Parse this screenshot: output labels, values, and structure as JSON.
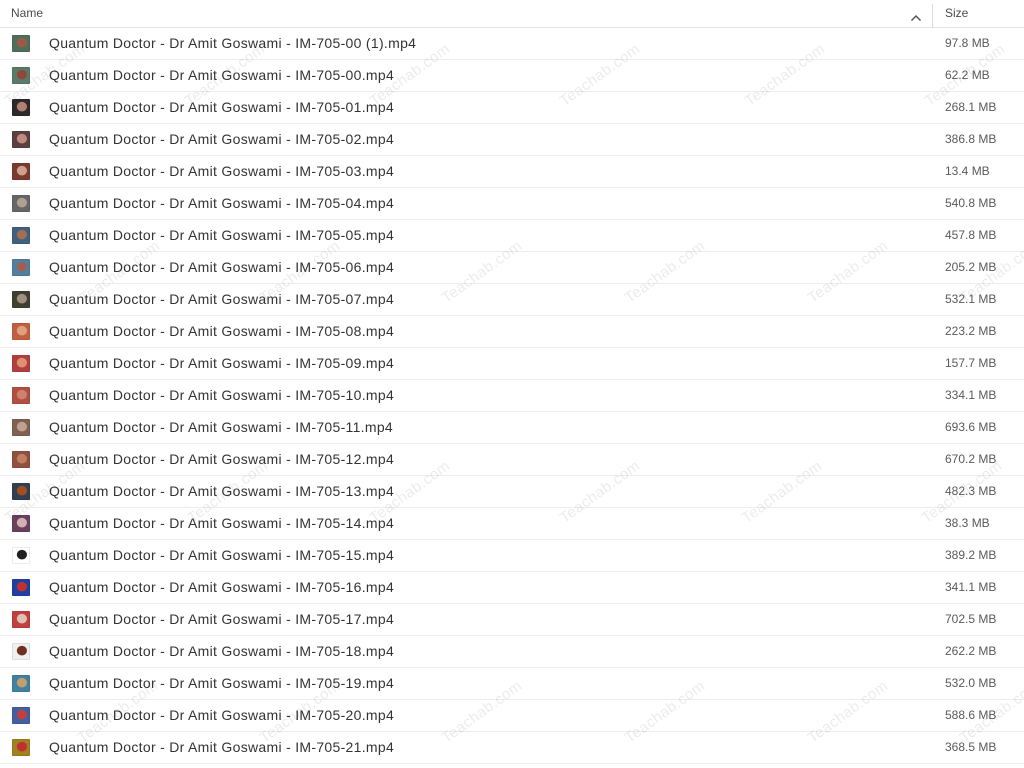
{
  "header": {
    "name_label": "Name",
    "size_label": "Size",
    "sort_icon": "chevron-up-icon"
  },
  "watermark": "Teachab.com",
  "files": [
    {
      "name": "Quantum Doctor - Dr Amit Goswami - IM-705-00 (1).mp4",
      "size": "97.8 MB",
      "thumb": [
        "#4f6e5a",
        "#9a5a46"
      ]
    },
    {
      "name": "Quantum Doctor - Dr Amit Goswami - IM-705-00.mp4",
      "size": "62.2 MB",
      "thumb": [
        "#5a7a6a",
        "#8c4a3a"
      ]
    },
    {
      "name": "Quantum Doctor - Dr Amit Goswami - IM-705-01.mp4",
      "size": "268.1 MB",
      "thumb": [
        "#2e2a2a",
        "#b08070"
      ]
    },
    {
      "name": "Quantum Doctor - Dr Amit Goswami - IM-705-02.mp4",
      "size": "386.8 MB",
      "thumb": [
        "#5a4040",
        "#c08a80"
      ]
    },
    {
      "name": "Quantum Doctor - Dr Amit Goswami - IM-705-03.mp4",
      "size": "13.4 MB",
      "thumb": [
        "#7a3a30",
        "#d0a090"
      ]
    },
    {
      "name": "Quantum Doctor - Dr Amit Goswami - IM-705-04.mp4",
      "size": "540.8 MB",
      "thumb": [
        "#666666",
        "#b0a090"
      ]
    },
    {
      "name": "Quantum Doctor - Dr Amit Goswami - IM-705-05.mp4",
      "size": "457.8 MB",
      "thumb": [
        "#406080",
        "#a07050"
      ]
    },
    {
      "name": "Quantum Doctor - Dr Amit Goswami - IM-705-06.mp4",
      "size": "205.2 MB",
      "thumb": [
        "#5080a0",
        "#a06050"
      ]
    },
    {
      "name": "Quantum Doctor - Dr Amit Goswami - IM-705-07.mp4",
      "size": "532.1 MB",
      "thumb": [
        "#404030",
        "#a09080"
      ]
    },
    {
      "name": "Quantum Doctor - Dr Amit Goswami - IM-705-08.mp4",
      "size": "223.2 MB",
      "thumb": [
        "#c06040",
        "#e0a080"
      ]
    },
    {
      "name": "Quantum Doctor - Dr Amit Goswami - IM-705-09.mp4",
      "size": "157.7 MB",
      "thumb": [
        "#b04040",
        "#e09070"
      ]
    },
    {
      "name": "Quantum Doctor - Dr Amit Goswami - IM-705-10.mp4",
      "size": "334.1 MB",
      "thumb": [
        "#b05040",
        "#d08070"
      ]
    },
    {
      "name": "Quantum Doctor - Dr Amit Goswami - IM-705-11.mp4",
      "size": "693.6 MB",
      "thumb": [
        "#806050",
        "#c0a090"
      ]
    },
    {
      "name": "Quantum Doctor - Dr Amit Goswami - IM-705-12.mp4",
      "size": "670.2 MB",
      "thumb": [
        "#905040",
        "#c08060"
      ]
    },
    {
      "name": "Quantum Doctor - Dr Amit Goswami - IM-705-13.mp4",
      "size": "482.3 MB",
      "thumb": [
        "#304050",
        "#a05020"
      ]
    },
    {
      "name": "Quantum Doctor - Dr Amit Goswami - IM-705-14.mp4",
      "size": "38.3 MB",
      "thumb": [
        "#6a4060",
        "#d0b0b0"
      ]
    },
    {
      "name": "Quantum Doctor - Dr Amit Goswami - IM-705-15.mp4",
      "size": "389.2 MB",
      "thumb": [
        "#ffffff",
        "#202020"
      ]
    },
    {
      "name": "Quantum Doctor - Dr Amit Goswami - IM-705-16.mp4",
      "size": "341.1 MB",
      "thumb": [
        "#2040a0",
        "#c03030"
      ]
    },
    {
      "name": "Quantum Doctor - Dr Amit Goswami - IM-705-17.mp4",
      "size": "702.5 MB",
      "thumb": [
        "#c04040",
        "#e0c0b0"
      ]
    },
    {
      "name": "Quantum Doctor - Dr Amit Goswami - IM-705-18.mp4",
      "size": "262.2 MB",
      "thumb": [
        "#f0f0f0",
        "#703020"
      ]
    },
    {
      "name": "Quantum Doctor - Dr Amit Goswami - IM-705-19.mp4",
      "size": "532.0 MB",
      "thumb": [
        "#4080a0",
        "#c0a070"
      ]
    },
    {
      "name": "Quantum Doctor - Dr Amit Goswami - IM-705-20.mp4",
      "size": "588.6 MB",
      "thumb": [
        "#4060a0",
        "#c04040"
      ]
    },
    {
      "name": "Quantum Doctor - Dr Amit Goswami - IM-705-21.mp4",
      "size": "368.5 MB",
      "thumb": [
        "#a08020",
        "#c03030"
      ]
    }
  ]
}
